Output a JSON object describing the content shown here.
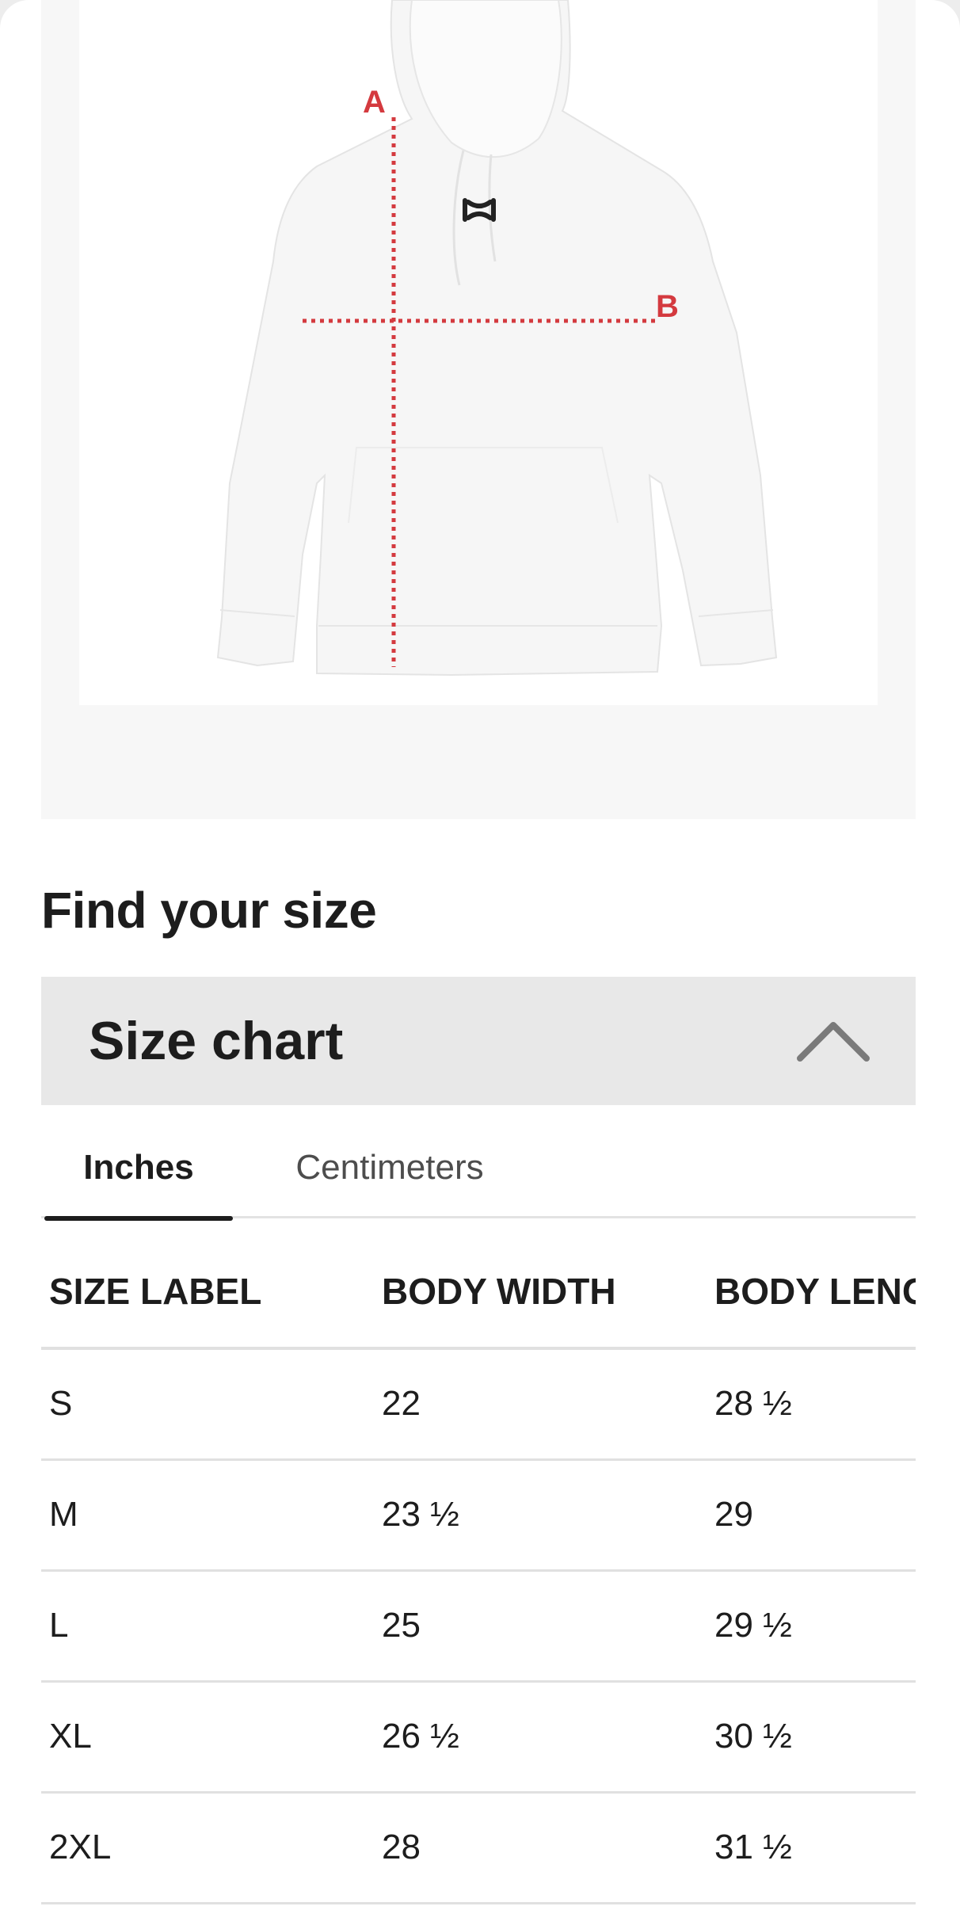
{
  "diagram": {
    "label_a": "A",
    "label_b": "B",
    "accent_color": "#d43a3f"
  },
  "find_size": {
    "title": "Find your size"
  },
  "size_chart": {
    "title": "Size chart",
    "toggle_icon": "chevron-up-icon",
    "expanded": true
  },
  "tabs": [
    {
      "label": "Inches",
      "selected": true
    },
    {
      "label": "Centimeters",
      "selected": false
    }
  ],
  "table": {
    "headers": [
      "SIZE LABEL",
      "BODY WIDTH",
      "BODY LENGTH"
    ],
    "rows": [
      [
        "S",
        "22",
        "28 ½"
      ],
      [
        "M",
        "23 ½",
        "29"
      ],
      [
        "L",
        "25",
        "29 ½"
      ],
      [
        "XL",
        "26 ½",
        "30 ½"
      ],
      [
        "2XL",
        "28",
        "31 ½"
      ]
    ]
  }
}
